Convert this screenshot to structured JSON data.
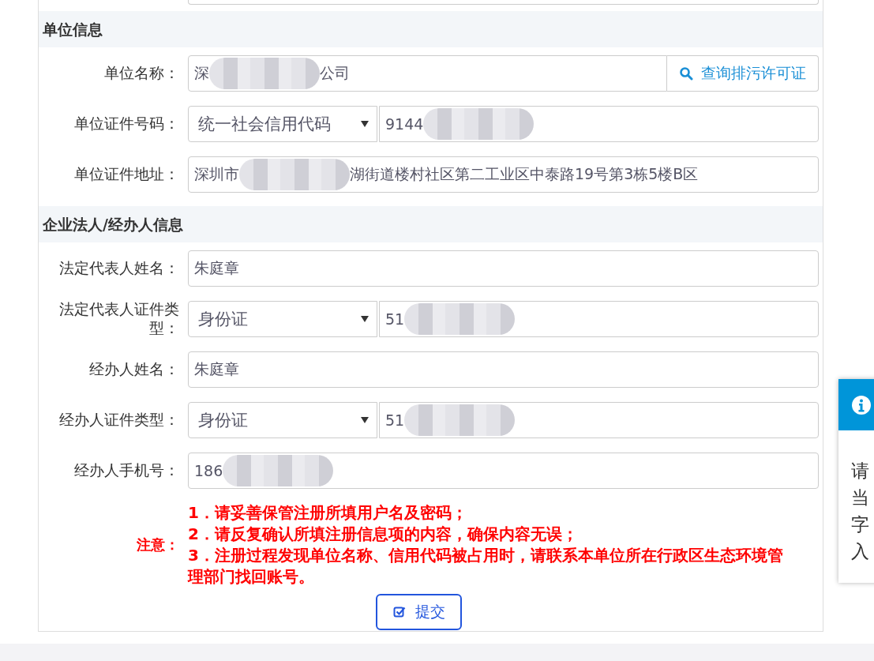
{
  "sections": [
    {
      "title": "单位信息",
      "rows": [
        {
          "kind": "text_button",
          "label": "单位名称：",
          "value": [
            {
              "text": "深"
            },
            {
              "kind": "redacted"
            },
            {
              "text": "公司"
            }
          ],
          "button": "查询排污许可证"
        },
        {
          "kind": "select_text",
          "label": "单位证件号码：",
          "select": "统一社会信用代码",
          "value": [
            {
              "text": "9144"
            },
            {
              "kind": "redacted"
            }
          ]
        },
        {
          "kind": "text",
          "label": "单位证件地址：",
          "value": [
            {
              "text": "深圳市"
            },
            {
              "kind": "redacted"
            },
            {
              "text": "湖街道楼村社区第二工业区中泰路19号第3栋5楼B区"
            }
          ]
        }
      ]
    },
    {
      "title": "企业法人/经办人信息",
      "rows": [
        {
          "kind": "text",
          "label": "法定代表人姓名：",
          "value": [
            {
              "text": "朱庭章"
            }
          ]
        },
        {
          "kind": "select_text",
          "label": "法定代表人证件类型：",
          "select": "身份证",
          "value": [
            {
              "text": "51"
            },
            {
              "kind": "redacted"
            }
          ]
        },
        {
          "kind": "text",
          "label": "经办人姓名：",
          "value": [
            {
              "text": "朱庭章"
            }
          ]
        },
        {
          "kind": "select_text",
          "label": "经办人证件类型：",
          "select": "身份证",
          "value": [
            {
              "text": "51"
            },
            {
              "kind": "redacted"
            }
          ]
        },
        {
          "kind": "text",
          "label": "经办人手机号：",
          "value": [
            {
              "text": "186"
            },
            {
              "kind": "redacted"
            }
          ]
        }
      ]
    }
  ],
  "notice": {
    "label": "注意：",
    "lines": [
      "1．请妥善保管注册所填用户名及密码；",
      "2．请反复确认所填注册信息项的内容，确保内容无误；",
      "3．注册过程发现单位名称、信用代码被占用时，请联系本单位所在行政区生态环境管理部门找回账号。"
    ]
  },
  "submit": {
    "label": "提交"
  },
  "popup": {
    "lines": [
      "请",
      "当",
      "字",
      "入"
    ]
  }
}
